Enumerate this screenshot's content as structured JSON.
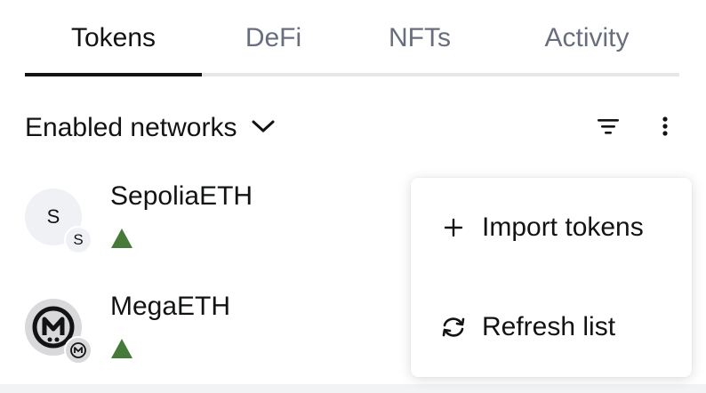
{
  "tabs": [
    {
      "label": "Tokens",
      "active": true
    },
    {
      "label": "DeFi",
      "active": false
    },
    {
      "label": "NFTs",
      "active": false
    },
    {
      "label": "Activity",
      "active": false
    }
  ],
  "network_filter": {
    "label": "Enabled networks",
    "icon": "chevron-down-icon"
  },
  "toolbar": {
    "sort_icon": "filter-sort-icon",
    "more_icon": "more-vertical-icon"
  },
  "tokens": [
    {
      "name": "SepoliaETH",
      "avatar_text": "S",
      "badge_text": "S",
      "trend_icon": "trend-up-icon",
      "trend_color": "#457a39"
    },
    {
      "name": "MegaETH",
      "avatar_text": "",
      "badge_text": "",
      "trend_icon": "trend-up-icon",
      "trend_color": "#457a39"
    }
  ],
  "menu": {
    "items": [
      {
        "label": "Import tokens",
        "icon": "plus-icon"
      },
      {
        "label": "Refresh list",
        "icon": "refresh-icon"
      }
    ]
  },
  "colors": {
    "text_primary": "#121314",
    "text_muted": "#686e7d",
    "divider": "#e6e7e9",
    "trend_up": "#457a39"
  }
}
